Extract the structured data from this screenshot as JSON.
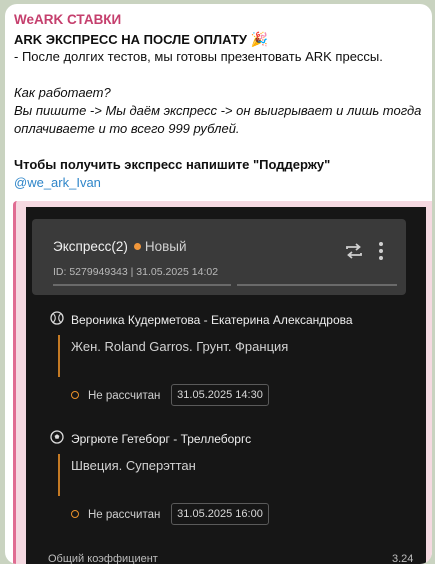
{
  "post": {
    "channel": "WeARK СТАВКИ",
    "title": "ARK ЭКСПРЕСС НА ПОСЛЕ ОПЛАТУ",
    "title_emoji": "🎉",
    "line2": "- После долгих тестов, мы готовы презентовать ARK прессы.",
    "how_q": "Как работает?",
    "how_1": "Вы пишите -> Мы даём экспресс -> он выигрывает и лишь тогда",
    "how_2": "оплачиваете и то всего 999 рублей.",
    "cta": "Чтобы получить экспресс напишите \"Поддержу\"",
    "handle": "@we_ark_Ivan"
  },
  "express": {
    "title": "Экспресс(2)",
    "status": "Новый",
    "id_line": "ID: 5279949343  |  31.05.2025 14:02",
    "matches": [
      {
        "teams": "Вероника Кудерметова - Екатерина Александрова",
        "league": "Жен. Roland Garros. Грунт. Франция",
        "state": "Не рассчитан",
        "date": "31.05.2025 14:30",
        "sport_icon": "tennis-ball-icon"
      },
      {
        "teams": "Эргрюте Гетеборг - Треллеборгс",
        "league": "Швеция. Суперэттан",
        "state": "Не рассчитан",
        "date": "31.05.2025 16:00",
        "sport_icon": "soccer-ball-icon"
      }
    ],
    "footer_left": "Общий коэффициент",
    "footer_right": "3.24"
  },
  "colors": {
    "channel": "#c53f6d",
    "link": "#2f86c9",
    "accent": "#e8902a",
    "dark_bg": "#161616"
  }
}
